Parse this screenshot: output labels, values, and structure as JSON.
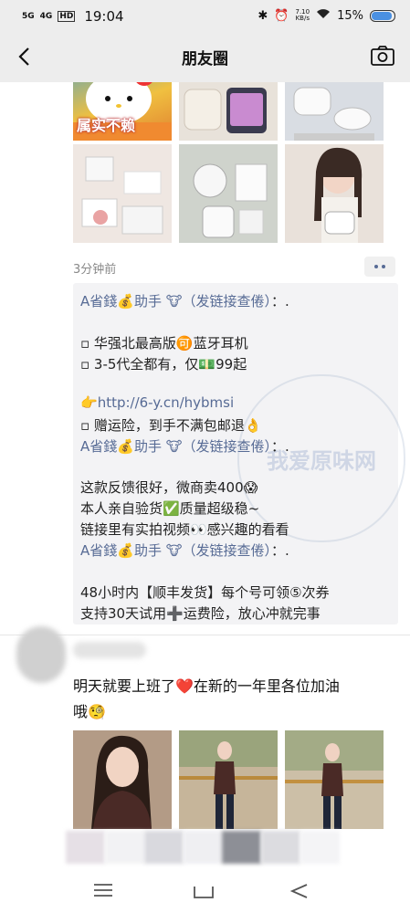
{
  "status": {
    "signal1": "5G",
    "signal2": "4G",
    "hd": "HD",
    "time": "19:04",
    "speed_top": "7.10",
    "speed_bottom": "KB/s",
    "battery": "15%"
  },
  "nav": {
    "title": "朋友圈"
  },
  "post1": {
    "image_caption": "属实不赖",
    "time_ago": "3分钟前",
    "comments": {
      "line1_name": "A省錢💰助手 🐮（发链接查倦）",
      "line1_suffix": "：.",
      "line2": "▫ 华强北最高版🉑蓝牙耳机",
      "line3": "▫ 3-5代全都有，仅💵99起",
      "line4_prefix": "👉",
      "line4_link": "http://6-y.cn/hybmsi",
      "line5": "▫ 赠运险，到手不满包邮退👌",
      "line6_name": "A省錢💰助手 🐮（发链接查倦）",
      "line6_suffix": "：.",
      "line7": "这款反馈很好，微商卖400😱",
      "line8": "本人亲自验货✅质量超级稳~",
      "line9": "链接里有实拍视频👀感兴趣的看看",
      "line10_name": "A省錢💰助手 🐮（发链接查倦）",
      "line10_suffix": "：.",
      "line11": "48小时内【顺丰发货】每个号可领⑤次券",
      "line12": "支持30天试用➕运费险，放心冲就完事"
    },
    "watermark": "我爱原味网"
  },
  "post2": {
    "text_line1": "明天就要上班了❤️在新的一年里各位加油",
    "text_line2": "哦🧐"
  },
  "icons": {
    "back": "chevron-left-icon",
    "camera": "camera-icon",
    "more": "more-dots-icon",
    "menu": "menu-icon",
    "home": "home-icon",
    "back_nav": "back-icon"
  },
  "colors": {
    "link": "#576b95",
    "header_bg": "#ededed",
    "comment_bg": "#f3f3f5",
    "battery": "#4a90e2"
  }
}
